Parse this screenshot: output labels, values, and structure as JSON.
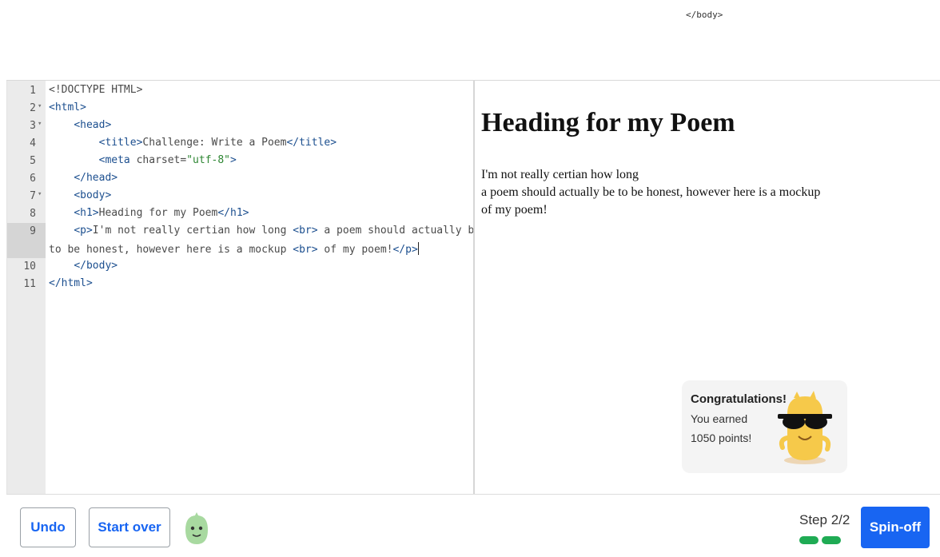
{
  "top_fragment": "</body>",
  "editor": {
    "lines": [
      {
        "n": "1",
        "fold": "",
        "parts": [
          {
            "c": "",
            "t": "<!DOCTYPE HTML>"
          }
        ]
      },
      {
        "n": "2",
        "fold": "▾",
        "parts": [
          {
            "c": "tag",
            "t": "<html>"
          }
        ]
      },
      {
        "n": "3",
        "fold": "▾",
        "parts": [
          {
            "c": "",
            "t": "    "
          },
          {
            "c": "tag",
            "t": "<head>"
          }
        ]
      },
      {
        "n": "4",
        "fold": "",
        "parts": [
          {
            "c": "",
            "t": "        "
          },
          {
            "c": "tag",
            "t": "<title>"
          },
          {
            "c": "",
            "t": "Challenge: Write a Poem"
          },
          {
            "c": "tag",
            "t": "</title>"
          }
        ]
      },
      {
        "n": "5",
        "fold": "",
        "parts": [
          {
            "c": "",
            "t": "        "
          },
          {
            "c": "tag",
            "t": "<meta "
          },
          {
            "c": "",
            "t": "charset="
          },
          {
            "c": "str",
            "t": "\"utf-8\""
          },
          {
            "c": "tag",
            "t": ">"
          }
        ]
      },
      {
        "n": "6",
        "fold": "",
        "parts": [
          {
            "c": "",
            "t": "    "
          },
          {
            "c": "tag",
            "t": "</head>"
          }
        ]
      },
      {
        "n": "7",
        "fold": "▾",
        "parts": [
          {
            "c": "",
            "t": "    "
          },
          {
            "c": "tag",
            "t": "<body>"
          }
        ]
      },
      {
        "n": "8",
        "fold": "",
        "parts": [
          {
            "c": "",
            "t": "    "
          },
          {
            "c": "tag",
            "t": "<h1>"
          },
          {
            "c": "",
            "t": "Heading for my Poem"
          },
          {
            "c": "tag",
            "t": "</h1>"
          }
        ]
      },
      {
        "n": "9",
        "fold": "",
        "parts": [
          {
            "c": "",
            "t": "    "
          },
          {
            "c": "tag",
            "t": "<p>"
          },
          {
            "c": "",
            "t": "I'm not really certian how long "
          },
          {
            "c": "tag",
            "t": "<br>"
          },
          {
            "c": "",
            "t": " a poem should actually be"
          }
        ]
      },
      {
        "n": "",
        "fold": "",
        "parts": [
          {
            "c": "",
            "t": "to be honest, however here is a mockup "
          },
          {
            "c": "tag",
            "t": "<br>"
          },
          {
            "c": "",
            "t": " of my poem!"
          },
          {
            "c": "tag",
            "t": "</p>"
          }
        ]
      },
      {
        "n": "10",
        "fold": "",
        "parts": [
          {
            "c": "",
            "t": "    "
          },
          {
            "c": "tag",
            "t": "</body>"
          }
        ]
      },
      {
        "n": "11",
        "fold": "",
        "parts": [
          {
            "c": "tag",
            "t": "</html>"
          }
        ]
      }
    ]
  },
  "preview": {
    "heading": "Heading for my Poem",
    "lines": [
      "I'm not really certian how long",
      "a poem should actually be to be honest, however here is a mockup",
      "of my poem!"
    ]
  },
  "toast": {
    "title": "Congratulations!",
    "line1": "You earned",
    "line2": "1050 points!"
  },
  "toolbar": {
    "undo_label": "Undo",
    "start_over_label": "Start over",
    "step_label": "Step 2/2",
    "spin_off_label": "Spin-off",
    "steps_completed": 2,
    "steps_total": 2
  },
  "colors": {
    "accent": "#1865f2",
    "progress": "#1fab54"
  }
}
